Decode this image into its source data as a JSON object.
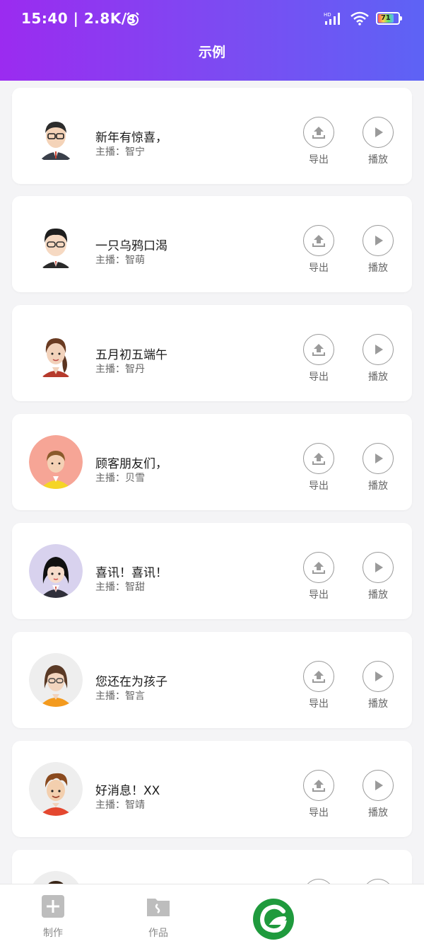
{
  "status_bar": {
    "time": "15:40 | 2.8K/s",
    "battery": "71"
  },
  "header": {
    "title": "示例"
  },
  "actions": {
    "export_label": "导出",
    "play_label": "播放"
  },
  "items": [
    {
      "title": "新年有惊喜，",
      "anchor": "主播：智宁"
    },
    {
      "title": "一只乌鸦口渴",
      "anchor": "主播：智萌"
    },
    {
      "title": "五月初五端午",
      "anchor": "主播：智丹"
    },
    {
      "title": "顾客朋友们，",
      "anchor": "主播：贝雪"
    },
    {
      "title": "喜讯！喜讯！",
      "anchor": "主播：智甜"
    },
    {
      "title": "您还在为孩子",
      "anchor": "主播：智言"
    },
    {
      "title": "好消息！XX",
      "anchor": "主播：智靖"
    }
  ],
  "tabbar": {
    "make_label": "制作",
    "works_label": "作品"
  },
  "colors": {
    "header_start": "#9b2bf0",
    "header_end": "#5d63f5",
    "logo_green": "#1f9a3d"
  }
}
